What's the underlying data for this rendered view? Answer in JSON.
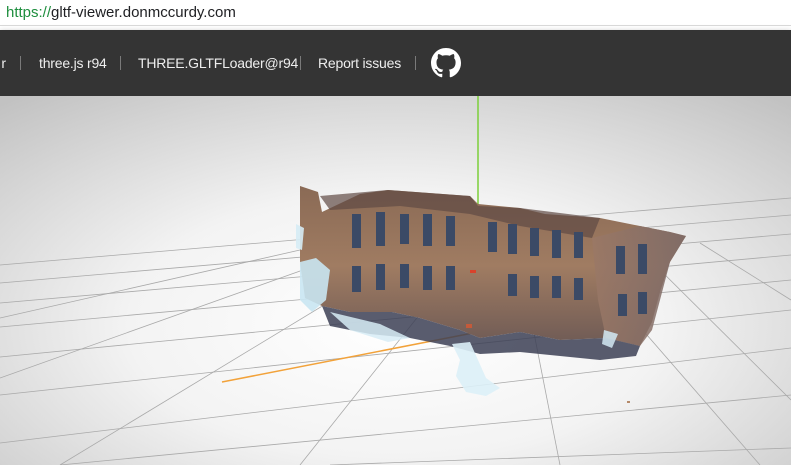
{
  "browser": {
    "url_scheme": "https://",
    "url_host": "gltf-viewer.donmccurdy.com"
  },
  "nav": {
    "clipped_item": "r",
    "items": [
      {
        "label": "three.js r94"
      },
      {
        "label": "THREE.GLTFLoader@r94"
      },
      {
        "label": "Report issues"
      }
    ],
    "github_icon": "github-icon"
  },
  "scene": {
    "model": "building-facade-scan",
    "axis_colors": {
      "y_axis": "#7ccf3a",
      "x_axis": "#f2a23a",
      "z_axis": "#3d86d9"
    },
    "grid": true
  }
}
